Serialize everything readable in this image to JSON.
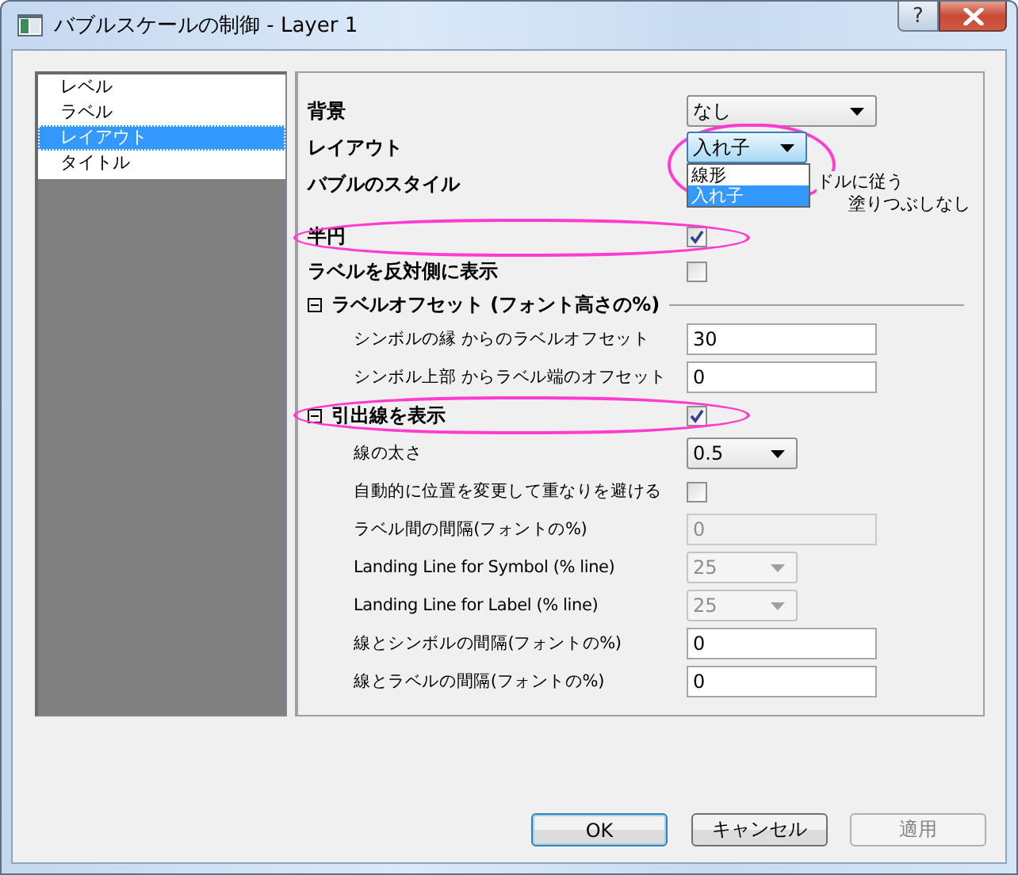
{
  "window": {
    "title": "バブルスケールの制御 - Layer 1",
    "help": "?"
  },
  "sidebar": {
    "items": [
      {
        "label": "レベル",
        "selected": false
      },
      {
        "label": "ラベル",
        "selected": false
      },
      {
        "label": "レイアウト",
        "selected": true
      },
      {
        "label": "タイトル",
        "selected": false
      }
    ]
  },
  "properties": [
    {
      "kind": "dropdown",
      "label": "背景",
      "value": "なし"
    },
    {
      "kind": "dropdown",
      "label": "レイアウト",
      "value": "入れ子",
      "expanded": true,
      "highlighted": true,
      "options": [
        {
          "label": "線形",
          "selected": false
        },
        {
          "label": "入れ子",
          "selected": true
        }
      ]
    },
    {
      "kind": "text",
      "label": "バブルのスタイル",
      "lines": [
        "ドルに従う",
        "塗りつぶしなし"
      ]
    },
    {
      "kind": "checkbox",
      "label": "半円",
      "checked": true,
      "highlighted": true
    },
    {
      "kind": "checkbox",
      "label": "ラベルを反対側に表示",
      "checked": false,
      "highlighted": false
    },
    {
      "kind": "group",
      "label": "ラベルオフセット (フォント高さの%)",
      "expanded": true,
      "children": [
        {
          "kind": "field",
          "label": "シンボルの縁 からのラベルオフセット",
          "value": "30",
          "disabled": false
        },
        {
          "kind": "field",
          "label": "シンボル上部 からラベル端のオフセット",
          "value": "0",
          "disabled": false
        }
      ]
    },
    {
      "kind": "group",
      "label": "引出線を表示",
      "expanded": true,
      "checked": true,
      "highlighted": true,
      "children": [
        {
          "kind": "dropdown",
          "label": "線の太さ",
          "value": "0.5"
        },
        {
          "kind": "checkbox",
          "label": "自動的に位置を変更して重なりを避ける",
          "checked": false
        },
        {
          "kind": "field",
          "label": "ラベル間の間隔(フォントの%)",
          "value": "0",
          "disabled": true
        },
        {
          "kind": "dropdown",
          "label": "Landing Line for Symbol (% line)",
          "value": "25",
          "disabled": true
        },
        {
          "kind": "dropdown",
          "label": "Landing Line for Label (% line)",
          "value": "25",
          "disabled": true
        },
        {
          "kind": "field",
          "label": "線とシンボルの間隔(フォントの%)",
          "value": "0",
          "disabled": false
        },
        {
          "kind": "field",
          "label": "線とラベルの間隔(フォントの%)",
          "value": "0",
          "disabled": false
        }
      ]
    }
  ],
  "buttons": [
    {
      "label": "OK",
      "default": true,
      "disabled": false
    },
    {
      "label": "キャンセル",
      "default": false,
      "disabled": false
    },
    {
      "label": "適用",
      "default": false,
      "disabled": true
    }
  ]
}
